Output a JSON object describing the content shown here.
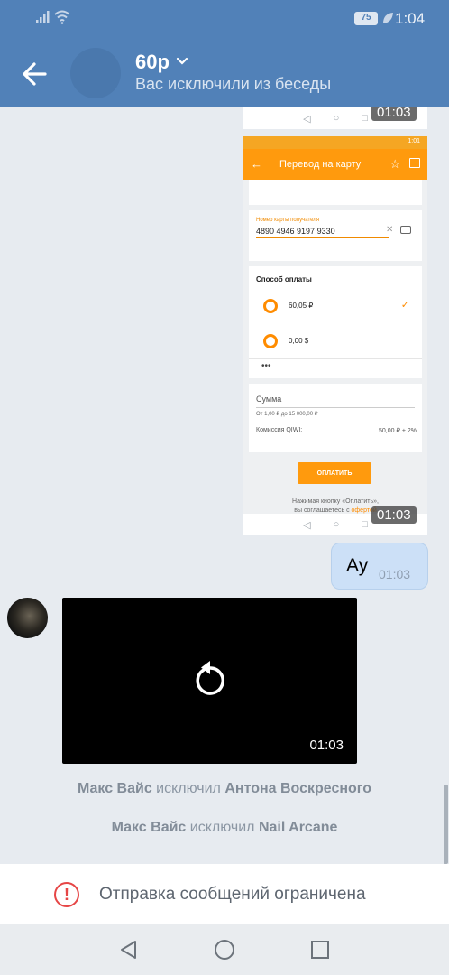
{
  "status_bar": {
    "battery": "75",
    "time": "1:04"
  },
  "header": {
    "title": "60р",
    "subtitle": "Вас исключили из беседы"
  },
  "messages": {
    "shot1_time": "01:03",
    "shot2_time": "01:03",
    "screenshot": {
      "appbar_title": "Перевод на карту",
      "card_label": "Номер карты получателя",
      "card_number": "4890 4946 9197 9330",
      "payment_title": "Способ оплаты",
      "option1": "60,05 ₽",
      "option2": "0,00 $",
      "dots": "•••",
      "sum_label": "Сумма",
      "sum_hint": "От 1,00 ₽ до 15 000,00 ₽",
      "fee_label": "Комиссия QIWI:",
      "fee_value": "50,00 ₽ + 2%",
      "pay_button": "ОПЛАТИТЬ",
      "note_line1": "Нажимая кнопку «Оплатить»,",
      "note_line2": "вы соглашаетесь с ",
      "note_link": "офертой",
      "status_time": "1:01"
    },
    "my_text": "Ау",
    "my_time": "01:03",
    "video_time": "01:03"
  },
  "system": [
    {
      "actor": "Макс Вайс",
      "verb": "исключил",
      "target": "Антона Воскресного"
    },
    {
      "actor": "Макс Вайс",
      "verb": "исключил",
      "target": "Nail Arcane"
    }
  ],
  "restricted": {
    "text": "Отправка сообщений ограничена"
  },
  "colors": {
    "header": "#5181b8",
    "accent": "#ff9a0d",
    "warning": "#e64646"
  }
}
